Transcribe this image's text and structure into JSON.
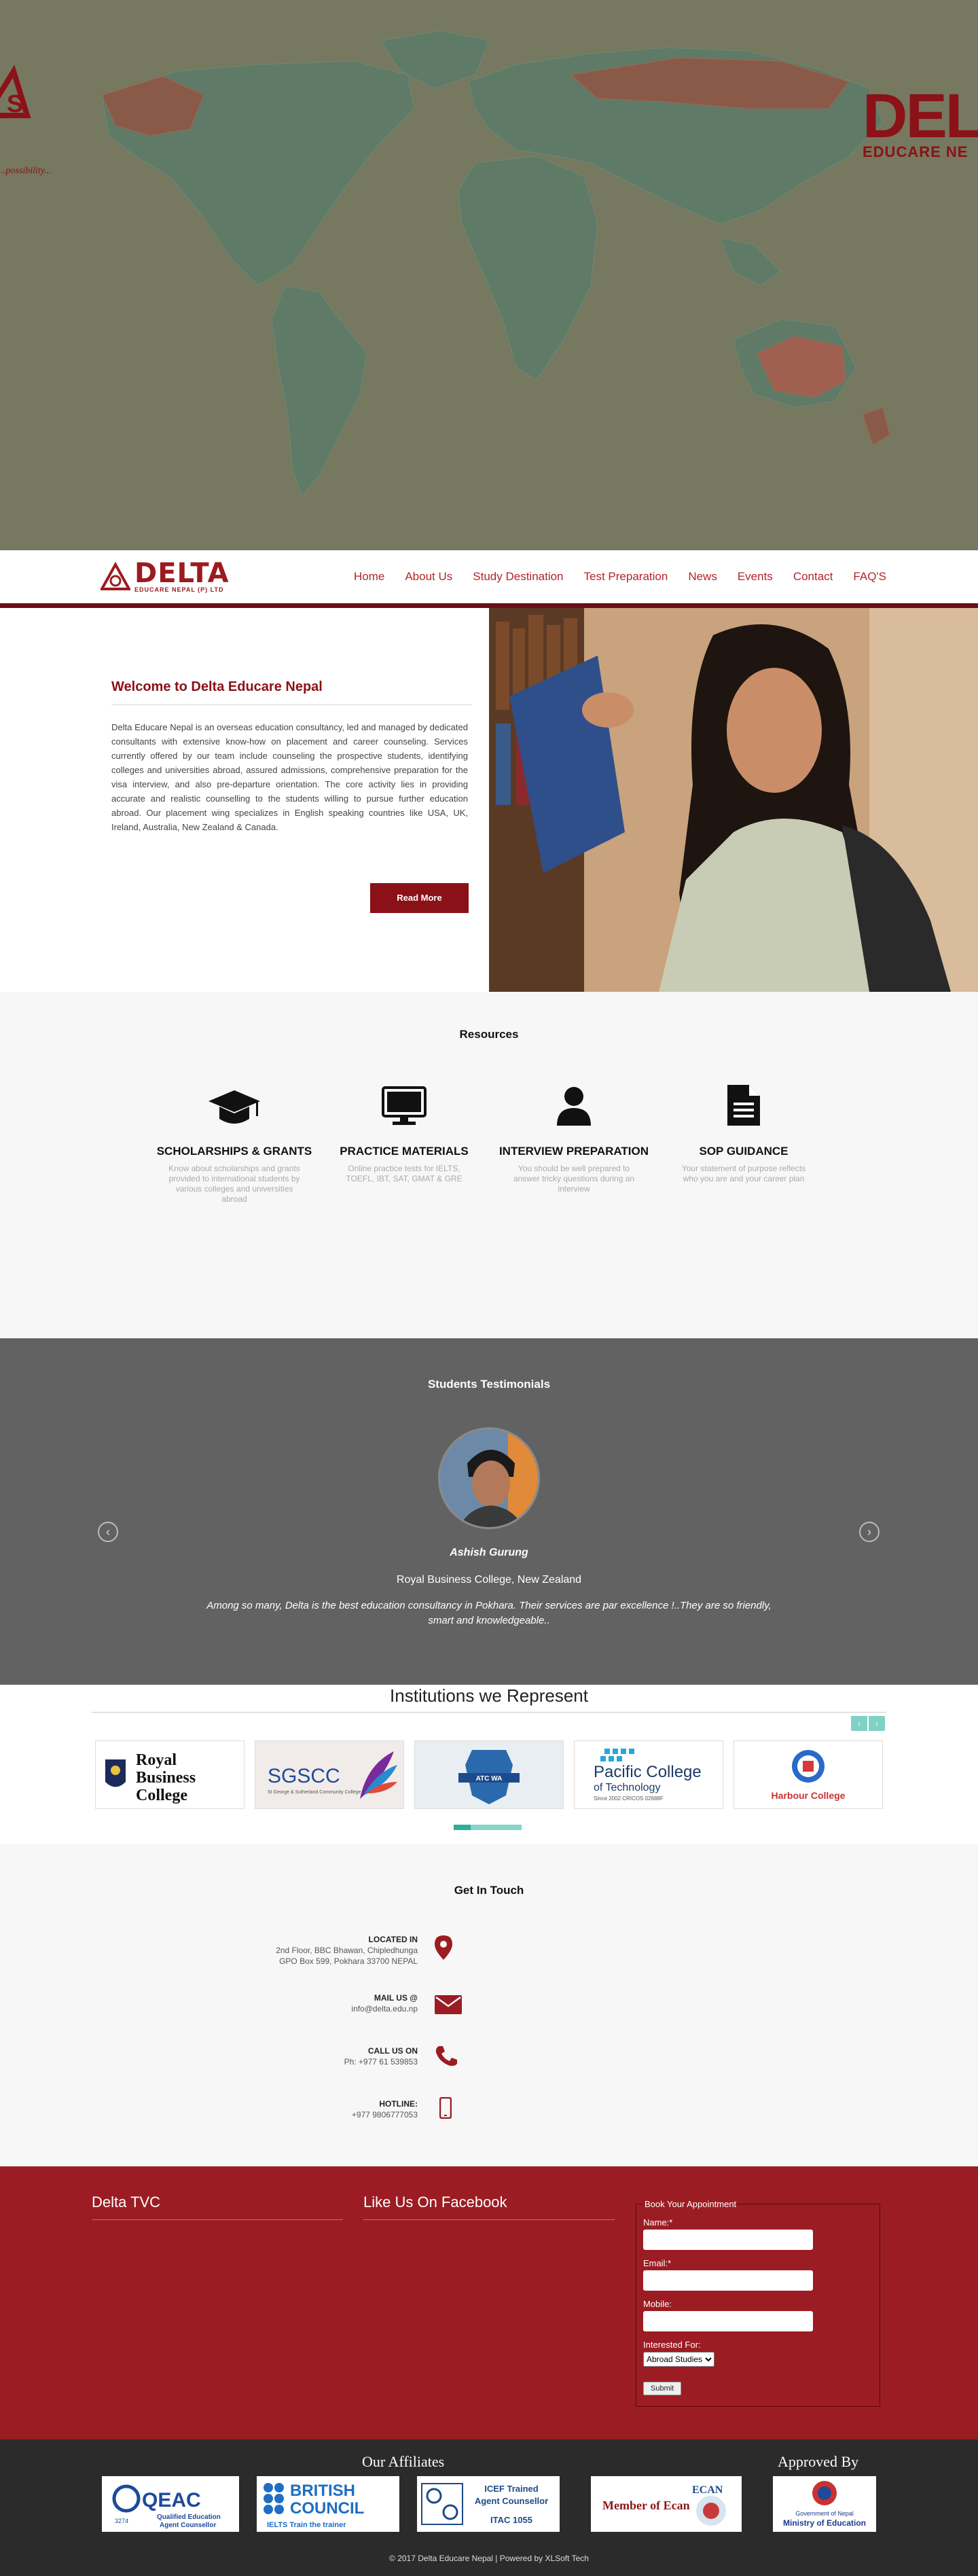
{
  "hero": {
    "brand_right_big": "DEL",
    "brand_right_small": "EDUCARE NE",
    "brand_left_caption": "...possibility..."
  },
  "nav": {
    "logo_word": "DELTA",
    "logo_sub": "EDUCARE NEPAL (P) LTD",
    "items": [
      "Home",
      "About Us",
      "Study Destination",
      "Test Preparation",
      "News",
      "Events",
      "Contact",
      "FAQ'S"
    ]
  },
  "welcome": {
    "title": "Welcome to Delta Educare Nepal",
    "body": "Delta Educare Nepal is an overseas education consultancy, led and managed by dedicated consultants with extensive know-how on placement and career counseling. Services currently offered by our team include counseling the prospective students, identifying colleges and universities abroad, assured admissions, comprehensive preparation for the visa interview, and also pre-departure orientation. The core activity lies in providing accurate and realistic counselling to the students willing to pursue further education abroad. Our placement wing specializes in English speaking countries like USA, UK, Ireland, Australia, New Zealand & Canada.",
    "button": "Read More"
  },
  "resources": {
    "title": "Resources",
    "items": [
      {
        "icon": "graduation-cap-icon",
        "title": "SCHOLARSHIPS & GRANTS",
        "desc": "Know about scholarships and grants provided to international students by various colleges and universities abroad"
      },
      {
        "icon": "monitor-icon",
        "title": "PRACTICE MATERIALS",
        "desc": "Online practice tests for IELTS, TOEFL, IBT, SAT, GMAT & GRE"
      },
      {
        "icon": "user-icon",
        "title": "INTERVIEW PREPARATION",
        "desc": "You should be well prepared to answer tricky questions during an interview"
      },
      {
        "icon": "document-icon",
        "title": "SOP GUIDANCE",
        "desc": "Your statement of purpose reflects who you are and your career plan"
      }
    ]
  },
  "testimonials": {
    "title": "Students Testimonials",
    "name": "Ashish Gurung",
    "school": "Royal Business College, New Zealand",
    "quote": "Among so many, Delta is the best education consultancy in Pokhara. Their services are par excellence !..They are so friendly, smart and knowledgeable..",
    "prev": "‹",
    "next": "›"
  },
  "institutions": {
    "title": "Institutions we Represent",
    "prev": "‹",
    "next": "›",
    "cards": {
      "royal": [
        "Royal",
        "Business",
        "College"
      ],
      "sgscc": {
        "name": "SGSCC",
        "sub": "St George & Sutherland Community College"
      },
      "atcwa": "ATC WA",
      "pacific": {
        "name": "Pacific College",
        "sub": "of Technology",
        "small": "Since 2002 CRICOS 02688F"
      },
      "harbour": "Harbour College"
    }
  },
  "contact": {
    "title": "Get In Touch",
    "location_label": "LOCATED IN",
    "location_1": "2nd Floor, BBC Bhawan, Chipledhunga",
    "location_2": "GPO Box 599, Pokhara 33700 NEPAL",
    "mail_label": "MAIL US @",
    "mail": "info@delta.edu.np",
    "call_label": "CALL US ON",
    "call": "Ph: +977 61 539853",
    "hotline_label": "HOTLINE:",
    "hotline": "+977 9806777053"
  },
  "footer": {
    "tvc": "Delta TVC",
    "facebook": "Like Us On Facebook",
    "form": {
      "legend": "Book Your Appointment",
      "name": "Name:*",
      "email": "Email:*",
      "mobile": "Mobile:",
      "interested": "Interested For:",
      "option": "Abroad Studies",
      "submit": "Submit"
    },
    "affiliates": "Our Affiliates",
    "approved": "Approved By",
    "logos": {
      "qeac": "QEAC",
      "qeac_num": "3274",
      "qeac_sub1": "Qualified Education",
      "qeac_sub2": "Agent Counsellor",
      "bc1": "BRITISH",
      "bc2": "COUNCIL",
      "bc_sub": "IELTS Train the trainer",
      "icef1": "ICEF Trained",
      "icef2": "Agent Counsellor",
      "icef3": "ITAC 1055",
      "ecan": "Member of Ecan",
      "ecan_logo": "ECAN",
      "gov1": "Government of Nepal",
      "gov2": "Ministry of Education"
    },
    "copyright": "© 2017 Delta Educare Nepal | Powered by XLSoft Tech"
  },
  "colors": {
    "brand": "#9c1c23",
    "hero_bg": "#76785f",
    "land": "#5f7a66",
    "teal": "#7fd1c5"
  }
}
